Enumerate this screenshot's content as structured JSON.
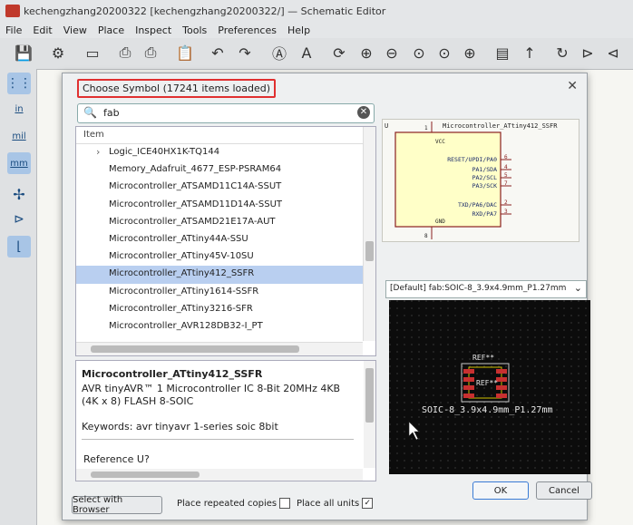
{
  "window": {
    "title": "kechengzhang20200322 [kechengzhang20200322/] — Schematic Editor"
  },
  "menu": [
    "File",
    "Edit",
    "View",
    "Place",
    "Inspect",
    "Tools",
    "Preferences",
    "Help"
  ],
  "left_toolbar": {
    "in_label": "in",
    "mil_label": "mil",
    "mm_label": "mm"
  },
  "dialog": {
    "title": "Choose Symbol (17241 items loaded)",
    "search": {
      "value": "fab"
    },
    "column_header": "Item",
    "items": [
      {
        "label": "Logic_ICE40HX1K-TQ144",
        "expandable": true
      },
      {
        "label": "Memory_Adafruit_4677_ESP-PSRAM64"
      },
      {
        "label": "Microcontroller_ATSAMD11C14A-SSUT"
      },
      {
        "label": "Microcontroller_ATSAMD11D14A-SSUT"
      },
      {
        "label": "Microcontroller_ATSAMD21E17A-AUT"
      },
      {
        "label": "Microcontroller_ATtiny44A-SSU"
      },
      {
        "label": "Microcontroller_ATtiny45V-10SU"
      },
      {
        "label": "Microcontroller_ATtiny412_SSFR",
        "selected": true
      },
      {
        "label": "Microcontroller_ATtiny1614-SSFR"
      },
      {
        "label": "Microcontroller_ATtiny3216-SFR"
      },
      {
        "label": "Microcontroller_AVR128DB32-I_PT"
      }
    ],
    "details": {
      "name": "Microcontroller_ATtiny412_SSFR",
      "description": "AVR tinyAVR™ 1 Microcontroller IC 8-Bit 20MHz 4KB (4K x 8) FLASH 8-SOIC",
      "keywords": "Keywords: avr tinyavr 1-series soic 8bit",
      "reference": "Reference  U?"
    },
    "symbol": {
      "ref": "U",
      "value": "Microcontroller_ATtiny412_SSFR",
      "top_pin": {
        "num": "1",
        "name": "VCC"
      },
      "bottom_pin": {
        "num": "8",
        "name": "GND"
      },
      "pins": [
        {
          "name": "RESET/UPDI/PA0",
          "num": "6"
        },
        {
          "name": "PA1/SDA",
          "num": "4"
        },
        {
          "name": "PA2/SCL",
          "num": "5"
        },
        {
          "name": "PA3/SCK",
          "num": "7"
        },
        {
          "name": "TXD/PA6/DAC",
          "num": "2"
        },
        {
          "name": "RXD/PA7",
          "num": "3"
        }
      ]
    },
    "footprint": {
      "selector": "[Default] fab:SOIC-8_3.9x4.9mm_P1.27mm",
      "ref_label": "REF**",
      "name_label": "SOIC-8_3.9x4.9mm_P1.27mm"
    },
    "select_browser": "Select with Browser",
    "place_repeated": "Place repeated copies",
    "place_all_units": "Place all units",
    "place_all_units_checked": "✓",
    "ok": "OK",
    "cancel": "Cancel"
  }
}
